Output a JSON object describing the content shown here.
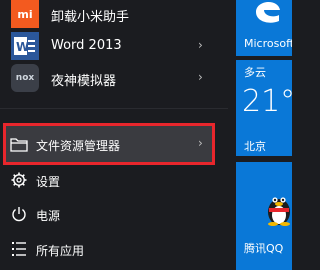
{
  "apps": [
    {
      "label": "卸载小米助手",
      "icon": "mi-icon",
      "icon_text": "mi",
      "icon_color": "#f35a1f",
      "has_submenu": false
    },
    {
      "label": "Word 2013",
      "icon": "word-icon",
      "icon_text": "W",
      "icon_color": "#2b579a",
      "has_submenu": true
    },
    {
      "label": "夜神模拟器",
      "icon": "nox-icon",
      "icon_text": "nox",
      "icon_color": "#3b3f48",
      "has_submenu": true
    }
  ],
  "system": {
    "file_explorer": "文件资源管理器",
    "settings": "设置",
    "power": "电源",
    "all_apps": "所有应用"
  },
  "tiles": {
    "edge": {
      "label": "Microsoft",
      "color": "#0a78d7"
    },
    "weather": {
      "condition": "多云",
      "temperature": "21°",
      "city": "北京",
      "color": "#0a78d7"
    },
    "qq": {
      "label": "腾讯QQ",
      "color": "#0a78d7"
    }
  },
  "colors": {
    "highlight_border": "#e8262c",
    "start_bg": "#1b1c20",
    "tile_blue": "#0a78d7"
  }
}
